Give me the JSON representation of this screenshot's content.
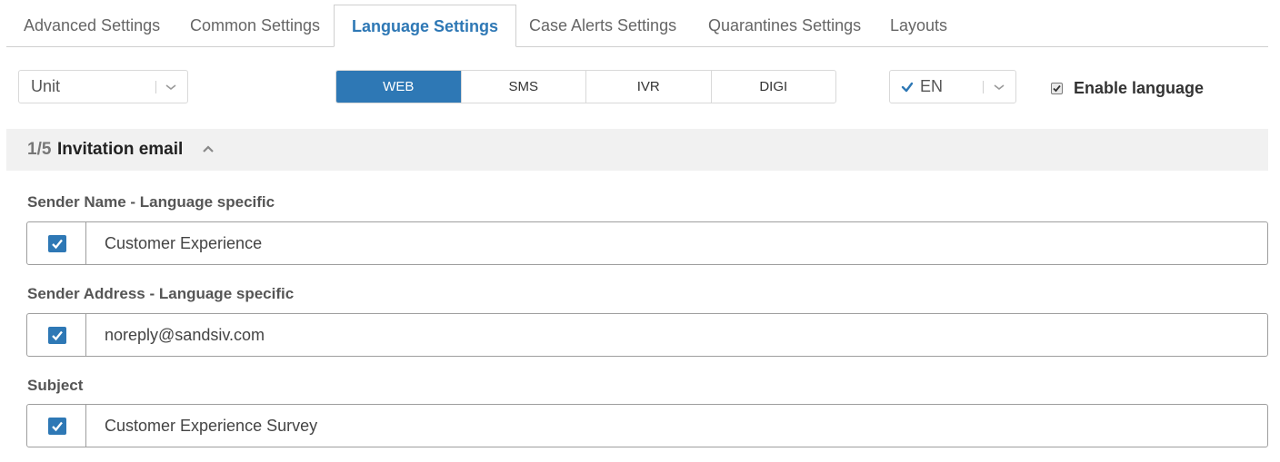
{
  "tabs": [
    {
      "label": "Advanced Settings",
      "active": false
    },
    {
      "label": "Common Settings",
      "active": false
    },
    {
      "label": "Language Settings",
      "active": true
    },
    {
      "label": "Case Alerts Settings",
      "active": false
    },
    {
      "label": "Quarantines Settings",
      "active": false
    },
    {
      "label": "Layouts",
      "active": false
    }
  ],
  "toolbar": {
    "unit_select": {
      "value": "Unit",
      "icon": "chevron-down-icon"
    },
    "channels": [
      {
        "label": "WEB",
        "active": true
      },
      {
        "label": "SMS",
        "active": false
      },
      {
        "label": "IVR",
        "active": false
      },
      {
        "label": "DIGI",
        "active": false
      }
    ],
    "language_select": {
      "value": "EN",
      "icon": "check-icon"
    },
    "enable_language": {
      "label": "Enable language",
      "checked": true
    }
  },
  "section": {
    "count": "1/5",
    "title": "Invitation email",
    "icon": "chevron-up-icon"
  },
  "fields": [
    {
      "label": "Sender Name - Language specific",
      "value": "Customer Experience",
      "checked": true
    },
    {
      "label": "Sender Address - Language specific",
      "value": "noreply@sandsiv.com",
      "checked": true
    },
    {
      "label": "Subject",
      "value": "Customer Experience Survey",
      "checked": true
    }
  ],
  "colors": {
    "accent": "#2e78b5",
    "section_bg": "#f1f1f1",
    "border": "#9e9e9e"
  }
}
